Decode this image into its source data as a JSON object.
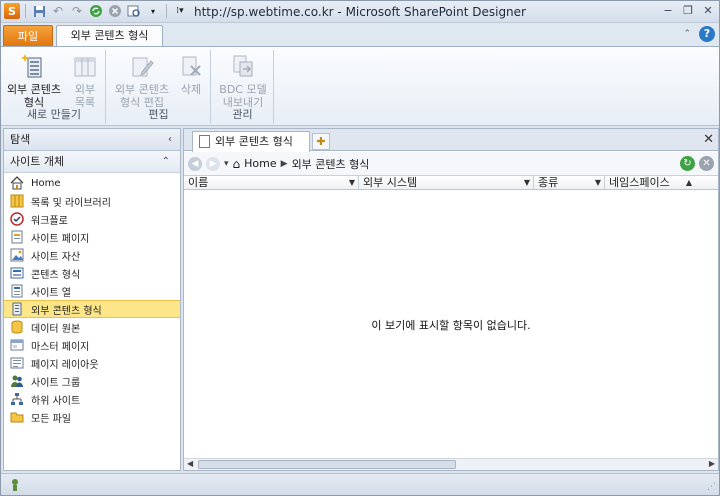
{
  "window": {
    "title": "http://sp.webtime.co.kr  -  Microsoft SharePoint Designer"
  },
  "ribbon": {
    "tabs": [
      {
        "label": "파일"
      },
      {
        "label": "외부 콘텐츠 형식"
      }
    ],
    "groups": [
      {
        "label": "새로 만들기",
        "buttons": [
          {
            "line1": "외부 콘텐츠",
            "line2": "형식",
            "enabled": true
          },
          {
            "line1": "외부",
            "line2": "목록",
            "enabled": false
          }
        ]
      },
      {
        "label": "편집",
        "buttons": [
          {
            "line1": "외부 콘텐츠",
            "line2": "형식 편집",
            "enabled": false
          },
          {
            "line1": "삭제",
            "line2": "",
            "enabled": false
          }
        ]
      },
      {
        "label": "관리",
        "buttons": [
          {
            "line1": "BDC 모델",
            "line2": "내보내기",
            "enabled": false
          }
        ]
      }
    ]
  },
  "nav": {
    "header": "탐색",
    "section": "사이트 개체",
    "items": [
      {
        "label": "Home",
        "icon": "home-icon"
      },
      {
        "label": "목록 및 라이브러리",
        "icon": "list-icon"
      },
      {
        "label": "워크플로",
        "icon": "workflow-icon"
      },
      {
        "label": "사이트 페이지",
        "icon": "page-icon"
      },
      {
        "label": "사이트 자산",
        "icon": "asset-icon"
      },
      {
        "label": "콘텐츠 형식",
        "icon": "content-type-icon"
      },
      {
        "label": "사이트 열",
        "icon": "column-icon"
      },
      {
        "label": "외부 콘텐츠 형식",
        "icon": "external-content-icon",
        "selected": true
      },
      {
        "label": "데이터 원본",
        "icon": "database-icon"
      },
      {
        "label": "마스터 페이지",
        "icon": "master-page-icon"
      },
      {
        "label": "페이지 레이아웃",
        "icon": "page-layout-icon"
      },
      {
        "label": "사이트 그룹",
        "icon": "group-icon"
      },
      {
        "label": "하위 사이트",
        "icon": "subsite-icon"
      },
      {
        "label": "모든 파일",
        "icon": "folder-icon"
      }
    ]
  },
  "main": {
    "tab_label": "외부 콘텐츠 형식",
    "breadcrumb": {
      "home": "Home",
      "current": "외부 콘텐츠 형식"
    },
    "columns": [
      "이름",
      "외부 시스템",
      "종류",
      "네임스페이스"
    ],
    "empty_message": "이 보기에 표시할 항목이 없습니다."
  },
  "colors": {
    "file_tab": "#e2760e",
    "selected_item": "#fde58a"
  }
}
